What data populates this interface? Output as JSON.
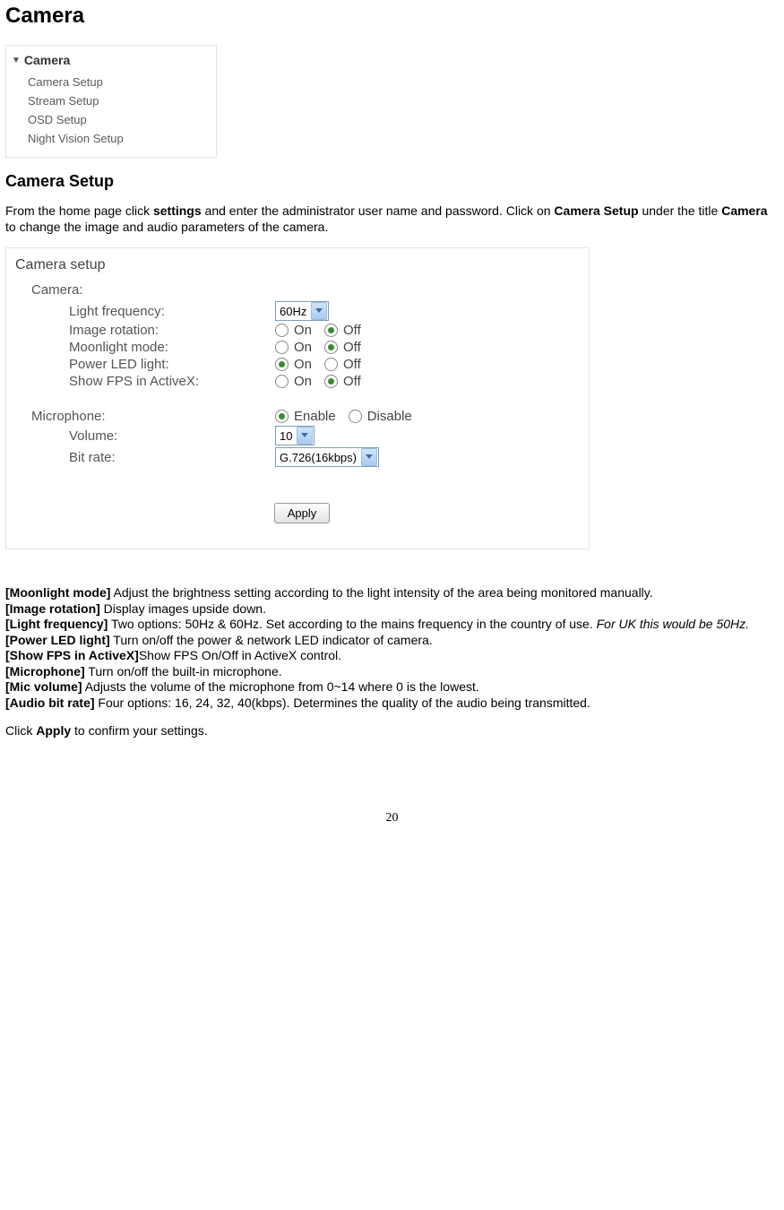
{
  "title": "Camera",
  "nav": {
    "header": "Camera",
    "items": [
      "Camera Setup",
      "Stream Setup",
      "OSD Setup",
      "Night Vision Setup"
    ]
  },
  "section_title": "Camera Setup",
  "intro": {
    "p1a": "From the home page click ",
    "p1b": "settings",
    "p1c": " and enter the administrator user name and password. Click on ",
    "p1d": "Camera Setup",
    "p1e": " under the title ",
    "p1f": "Camera",
    "p1g": " to change the image and audio parameters of the camera."
  },
  "setup": {
    "title": "Camera setup",
    "group_camera": "Camera:",
    "rows": {
      "light_freq": {
        "label": "Light frequency:",
        "value": "60Hz"
      },
      "image_rotation": {
        "label": "Image rotation:",
        "on": "On",
        "off": "Off",
        "selected": "off"
      },
      "moonlight": {
        "label": "Moonlight mode:",
        "on": "On",
        "off": "Off",
        "selected": "off"
      },
      "power_led": {
        "label": "Power LED light:",
        "on": "On",
        "off": "Off",
        "selected": "on"
      },
      "show_fps": {
        "label": "Show FPS in ActiveX:",
        "on": "On",
        "off": "Off",
        "selected": "off"
      }
    },
    "mic": {
      "label": "Microphone:",
      "enable": "Enable",
      "disable": "Disable",
      "selected": "enable"
    },
    "volume": {
      "label": "Volume:",
      "value": "10"
    },
    "bitrate": {
      "label": "Bit rate:",
      "value": "G.726(16kbps)"
    },
    "apply": "Apply"
  },
  "desc": {
    "d1a": "[Moonlight mode]",
    "d1b": " Adjust the brightness setting according to the light intensity of the area being monitored manually.",
    "d2a": "[Image rotation]",
    "d2b": " Display images upside down.",
    "d3a": "[Light frequency]",
    "d3b": " Two options: 50Hz & 60Hz. Set according to the mains frequency in the country of use. ",
    "d3c": "For UK this would be 50Hz.",
    "d4a": "[Power LED light]",
    "d4b": " Turn on/off the power & network LED indicator of camera.",
    "d5a": "[Show FPS in ActiveX]",
    "d5b": "Show FPS On/Off in ActiveX control.",
    "d6a": "[Microphone]",
    "d6b": " Turn on/off the built-in microphone.",
    "d7a": "[Mic volume]",
    "d7b": " Adjusts the volume of the microphone from 0~14 where 0 is the lowest.",
    "d8a": "[Audio bit rate]",
    "d8b": " Four options: 16, 24, 32, 40(kbps). Determines the quality of the audio being transmitted."
  },
  "footer": {
    "a": "Click ",
    "b": "Apply",
    "c": " to confirm your settings."
  },
  "page_number": "20"
}
